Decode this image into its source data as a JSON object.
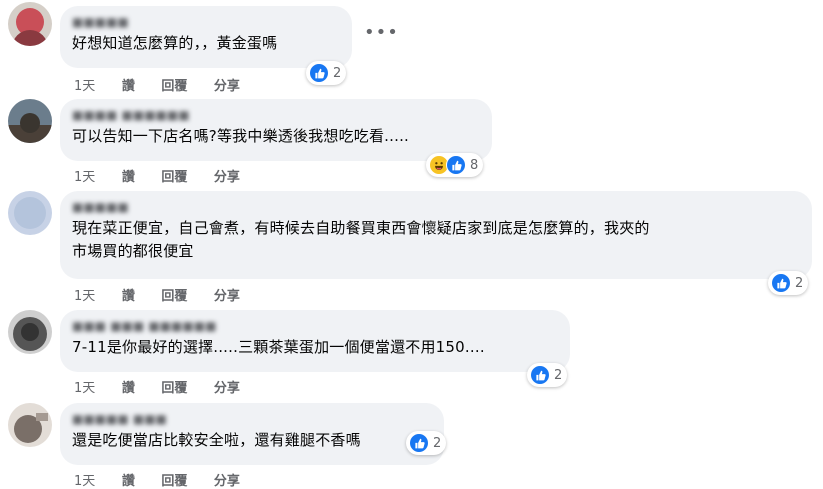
{
  "actions": {
    "time": "1天",
    "like": "讚",
    "reply": "回覆",
    "share": "分享"
  },
  "more_icon": "more-options-icon",
  "comments": [
    {
      "author": "■■■■■",
      "text": "好想知道怎麼算的，，黃金蛋嗎",
      "reaction_count": "2",
      "avatar_color": "#c94f58"
    },
    {
      "author": "■■■■ ■■■■■■",
      "text": "可以告知一下店名嗎?等我中樂透後我想吃吃看.....",
      "reaction_count": "8",
      "avatar_color": "#6b7d8c"
    },
    {
      "author": "■■■■■",
      "text_line1": "現在菜正便宜，自己會煮，有時候去自助餐買東西會懷疑店家到底是怎麼算的，我夾的",
      "text_line2": "市場買的都很便宜",
      "reaction_count": "2",
      "avatar_color": "#b4c4dc"
    },
    {
      "author": "■■■ ■■■ ■■■■■■",
      "text": "7-11是你最好的選擇.....三顆茶葉蛋加一個便當還不用150....",
      "reaction_count": "2",
      "avatar_color": "#555555"
    },
    {
      "author": "■■■■■ ■■■",
      "text": "還是吃便當店比較安全啦，還有雞腿不香嗎",
      "reaction_count": "2",
      "avatar_color": "#7a6f68"
    }
  ]
}
